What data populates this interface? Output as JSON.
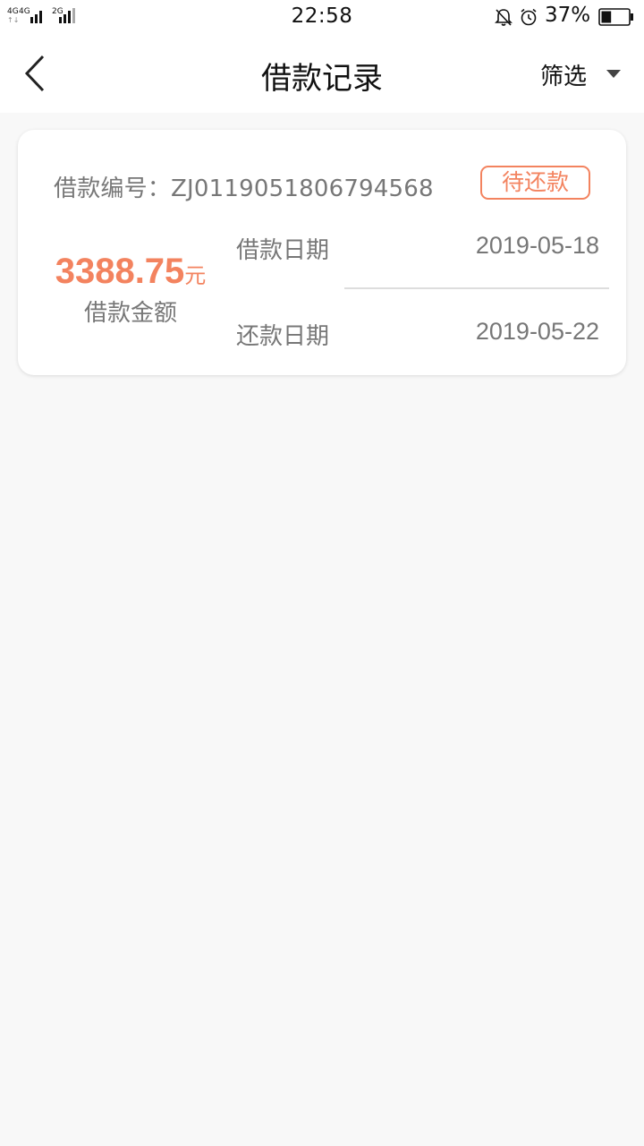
{
  "status_bar": {
    "network_1": "4G",
    "network_2": "4G",
    "network_3": "2G",
    "time": "22:58",
    "battery": "37%",
    "battery_level": 0.37,
    "icons": [
      "bell-off-icon",
      "alarm-icon",
      "battery-icon"
    ]
  },
  "nav": {
    "title": "借款记录",
    "filter_label": "筛选"
  },
  "record": {
    "loan_no_label": "借款编号：",
    "loan_no": "ZJ0119051806794568",
    "status": "待还款",
    "amount": "3388.75",
    "amount_unit": "元",
    "amount_label": "借款金额",
    "loan_date_label": "借款日期",
    "loan_date": "2019-05-18",
    "repay_date_label": "还款日期",
    "repay_date": "2019-05-22"
  },
  "colors": {
    "accent": "#f3835f",
    "background": "#f8f8f8",
    "card": "#ffffff"
  }
}
